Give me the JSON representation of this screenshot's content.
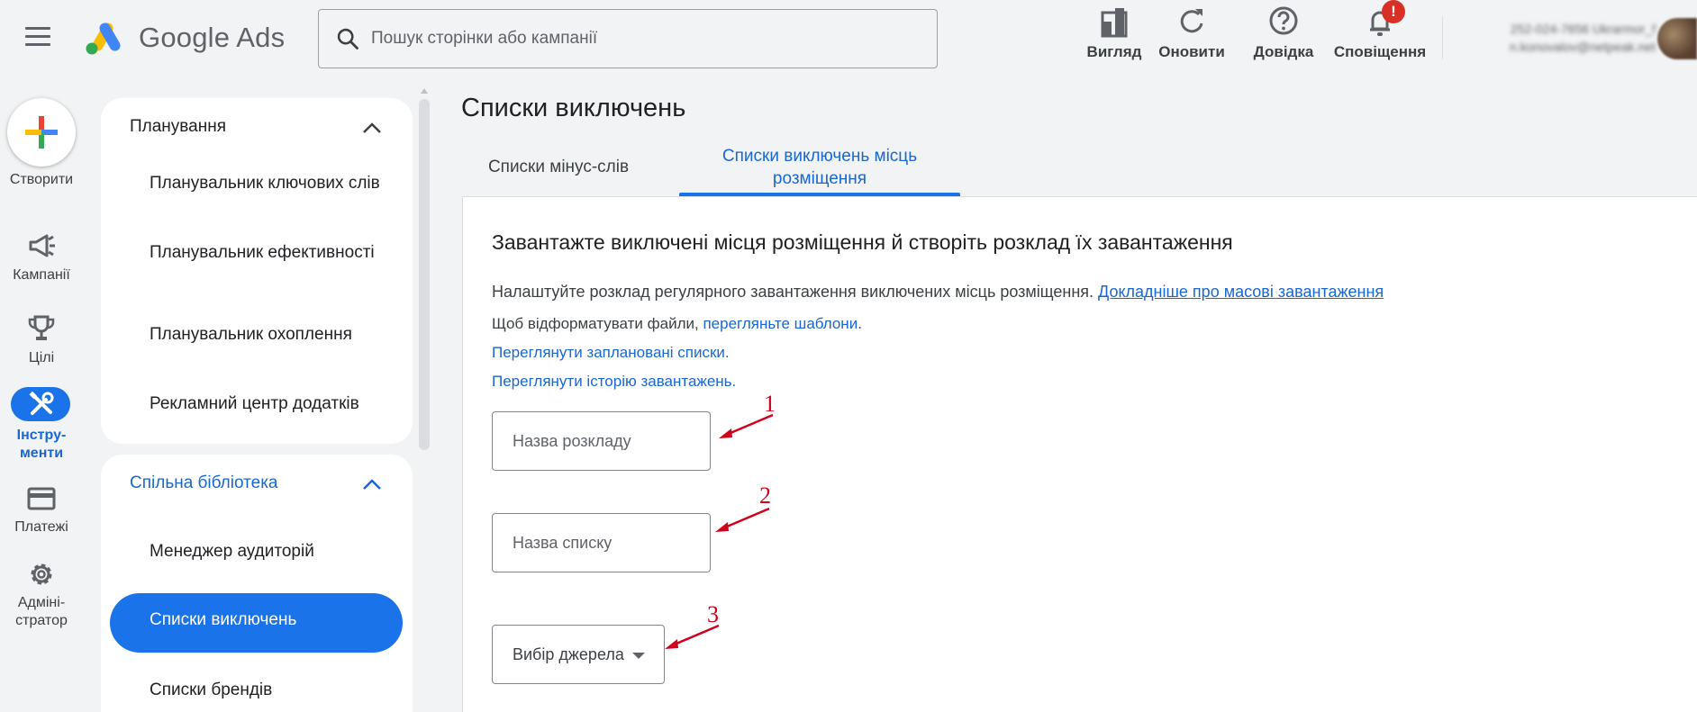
{
  "header": {
    "app_name": "Google Ads",
    "search_placeholder": "Пошук сторінки або кампанії",
    "actions": [
      {
        "label": "Вигляд",
        "icon": "appearance-icon"
      },
      {
        "label": "Оновити",
        "icon": "refresh-icon"
      },
      {
        "label": "Довідка",
        "icon": "help-icon"
      },
      {
        "label": "Сповіщення",
        "icon": "bell-icon"
      }
    ],
    "notification_badge": "!",
    "account_id": "252-024-7656 Ukrarmor_f",
    "account_email": "n.konovalov@netpeak.net"
  },
  "rail": {
    "create_label": "Створити",
    "items": [
      {
        "label": "Кампанії",
        "icon": "megaphone-icon"
      },
      {
        "label": "Цілі",
        "icon": "trophy-icon"
      },
      {
        "label_line1": "Інстру-",
        "label_line2": "менти",
        "icon": "tools-icon"
      },
      {
        "label": "Платежі",
        "icon": "credit-card-icon"
      },
      {
        "label_line1": "Адміні-",
        "label_line2": "стратор",
        "icon": "gear-icon"
      }
    ]
  },
  "nav": {
    "planning": {
      "title": "Планування",
      "items": [
        "Планувальник ключових слів",
        "Планувальник ефективності",
        "Планувальник охоплення",
        "Рекламний центр додатків"
      ]
    },
    "shared_library": {
      "title": "Спільна бібліотека",
      "items": [
        "Менеджер аудиторій",
        "Списки виключень",
        "Списки брендів"
      ]
    }
  },
  "main": {
    "title": "Списки виключень",
    "tabs": [
      {
        "label": "Списки мінус-слів"
      },
      {
        "label_line1": "Списки виключень місць",
        "label_line2": "розміщення"
      }
    ],
    "heading": "Завантажте виключені місця розміщення й створіть розклад їх завантаження",
    "description": "Налаштуйте розклад регулярного завантаження виключених місць розміщення.",
    "learn_more_link": "Докладніше про масові завантаження",
    "format_text": "Щоб відформатувати файли,",
    "templates_link": "перегляньте шаблони",
    "scheduled_link": "Переглянути заплановані списки.",
    "history_link": "Переглянути історію завантажень.",
    "schedule_name_placeholder": "Назва розкладу",
    "list_name_placeholder": "Назва списку",
    "source_select": "Вибір джерела",
    "annotations": [
      "1",
      "2",
      "3"
    ]
  },
  "colors": {
    "accent": "#1a73e8",
    "link": "#1967d2",
    "annotation": "#d0021b",
    "badge": "#d93025"
  }
}
